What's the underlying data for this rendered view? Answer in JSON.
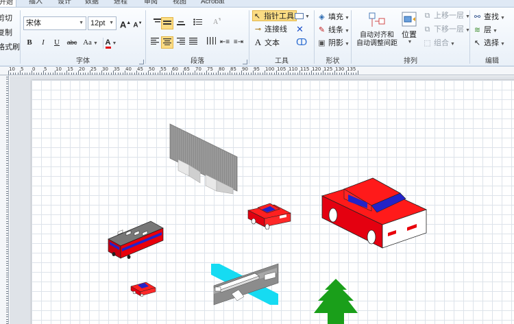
{
  "tabs": [
    "开始",
    "插入",
    "设计",
    "数据",
    "进程",
    "审阅",
    "视图",
    "Acrobat"
  ],
  "clipboard": {
    "cut": "剪切",
    "copy": "复制",
    "format_painter": "格式刷"
  },
  "font_group": {
    "label": "字体",
    "font_name": "宋体",
    "font_size": "12pt",
    "grow": "A",
    "shrink": "A",
    "bold": "B",
    "italic": "I",
    "underline": "U",
    "strike": "abc",
    "case": "Aa",
    "color_letter": "A"
  },
  "paragraph_group": {
    "label": "段落"
  },
  "tools_group": {
    "label": "工具",
    "pointer": "指针工具",
    "connector": "连接线",
    "text": "文本"
  },
  "shape_group": {
    "label": "形状",
    "fill": "填充",
    "line": "线条",
    "shadow": "阴影"
  },
  "arrange_group": {
    "label": "排列",
    "auto_align_1": "自动对齐和",
    "auto_align_2": "自动调整间距",
    "position": "位置",
    "bring_forward": "上移一层",
    "send_backward": "下移一层",
    "group": "组合"
  },
  "edit_group": {
    "label": "编辑",
    "find": "查找",
    "layer": "层",
    "select": "选择"
  },
  "ruler_numbers": [
    "10",
    "5",
    "0",
    "5",
    "10",
    "15",
    "20",
    "25",
    "30",
    "35",
    "40",
    "45",
    "50",
    "55",
    "60",
    "65",
    "70",
    "75",
    "80",
    "85",
    "90",
    "95",
    "100",
    "105",
    "110",
    "115",
    "120",
    "125",
    "130",
    "135"
  ],
  "colors": {
    "ribbon_bg": "#e9f0f8",
    "selected": "#fbdc84",
    "car_red": "#e8000b",
    "car_blue": "#2323c8",
    "tree_green": "#1a9f1a",
    "water_cyan": "#16dbf2",
    "grid": "#dde3ea"
  },
  "diagram_shapes": [
    "billboard",
    "small-car",
    "large-car",
    "bus",
    "tiny-car",
    "bridge",
    "tree"
  ]
}
